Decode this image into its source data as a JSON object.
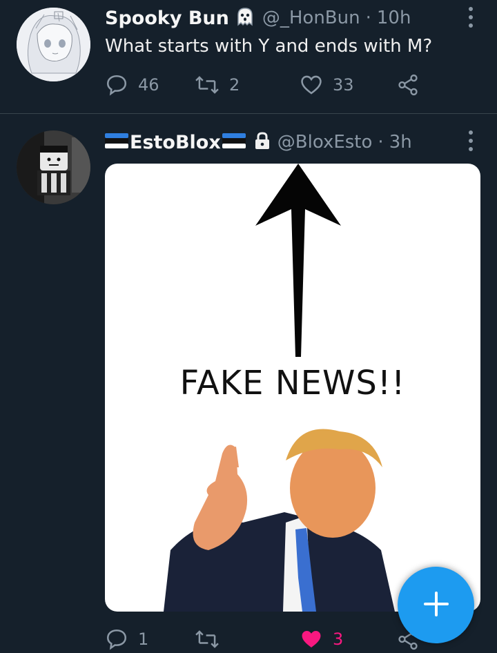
{
  "tweets": [
    {
      "name": "Spooky Bun",
      "name_emoji": "ghost-icon",
      "handle": "@_HonBun",
      "separator": "·",
      "time": "10h",
      "text": "What starts with Y and ends with M?",
      "replies": "46",
      "retweets": "2",
      "likes": "33"
    },
    {
      "name": "EstoBlox",
      "flag": "estonia-flag-icon",
      "locked": true,
      "handle": "@BloxEsto",
      "separator": "·",
      "time": "3h",
      "media_text": "FAKE NEWS!!",
      "replies": "1",
      "retweets": "",
      "likes": "3",
      "liked": true
    }
  ],
  "colors": {
    "background": "#15202b",
    "accent": "#1d9bf0",
    "like": "#f91880",
    "muted": "#8b98a5"
  }
}
